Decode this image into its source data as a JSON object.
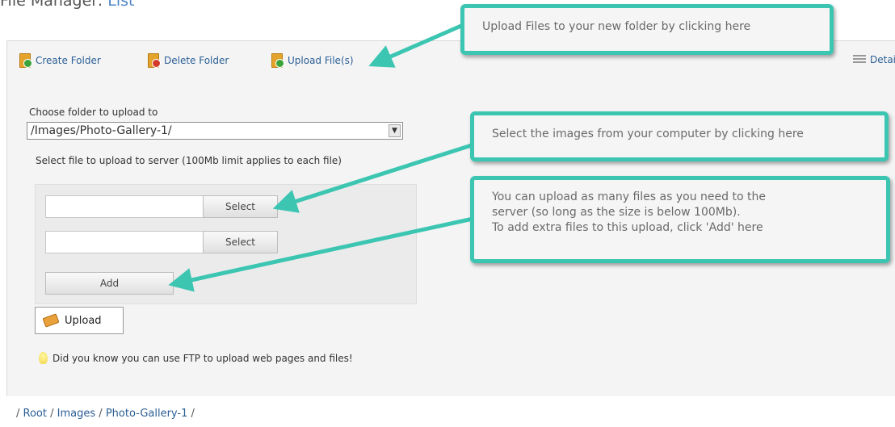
{
  "header": {
    "title_prefix": "File Manager:",
    "title_link": "List"
  },
  "toolbar": {
    "create_folder": "Create Folder",
    "delete_folder": "Delete Folder",
    "upload_files": "Upload File(s)",
    "details": "Details"
  },
  "form": {
    "choose_label": "Choose folder to upload to",
    "folder_value": "/Images/Photo-Gallery-1/",
    "select_hint": "Select file to upload to server (100Mb limit applies to each file)",
    "select_button_1": "Select",
    "select_button_2": "Select",
    "add_button": "Add",
    "upload_button": "Upload",
    "tip": "Did you know you can use FTP to upload web pages and files!"
  },
  "breadcrumb": {
    "sep": "/",
    "items": [
      "Root",
      "Images",
      "Photo-Gallery-1"
    ]
  },
  "callouts": {
    "upload_tip": "Upload Files to your new folder by clicking here",
    "select_tip": "Select the images from your computer by clicking here",
    "add_tip": "You can upload as many files as you need to the\nserver (so long as the size is below 100Mb).\nTo add extra files to this upload, click 'Add' here"
  },
  "colors": {
    "callout_border": "#3cc6b2",
    "link": "#2b5e95"
  }
}
